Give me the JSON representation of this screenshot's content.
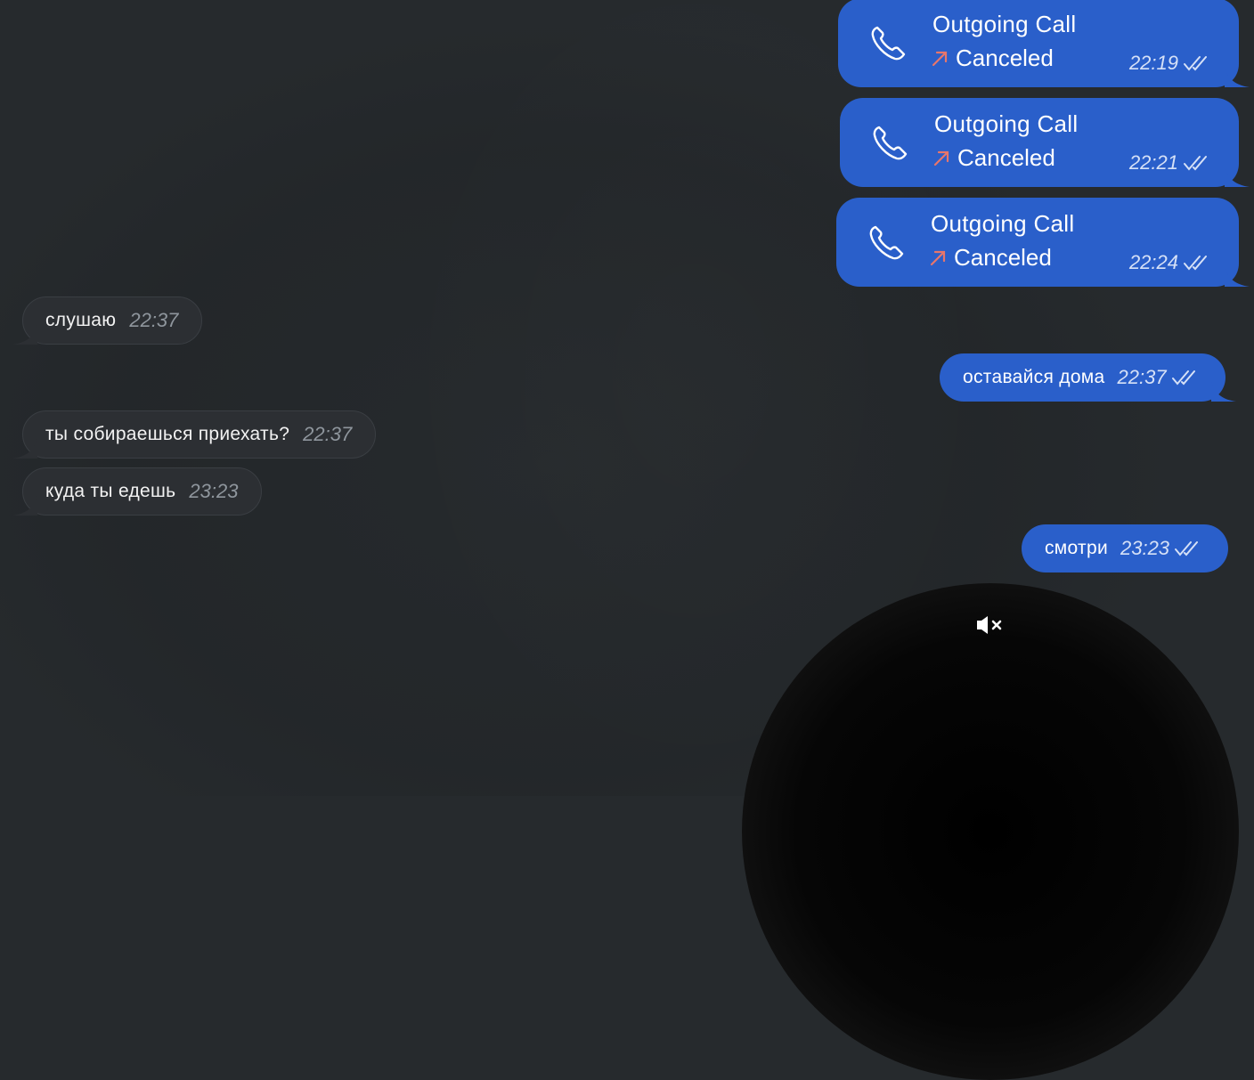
{
  "colors": {
    "background": "#262a2d",
    "outgoing_bubble": "#2a5fca",
    "incoming_bubble": "#2c2f33",
    "canceled_arrow": "#e8766b",
    "meta_text": "#d6e1f7",
    "incoming_time": "#8f969d"
  },
  "calls": [
    {
      "title": "Outgoing Call",
      "status": "Canceled",
      "time": "22:19",
      "icon": "phone-icon",
      "status_icon": "arrow-up-right-icon",
      "read": "double-check-icon"
    },
    {
      "title": "Outgoing Call",
      "status": "Canceled",
      "time": "22:21",
      "icon": "phone-icon",
      "status_icon": "arrow-up-right-icon",
      "read": "double-check-icon"
    },
    {
      "title": "Outgoing Call",
      "status": "Canceled",
      "time": "22:24",
      "icon": "phone-icon",
      "status_icon": "arrow-up-right-icon",
      "read": "double-check-icon"
    }
  ],
  "incoming": [
    {
      "text": "слушаю",
      "time": "22:37"
    },
    {
      "text": "ты собираешься приехать?",
      "time": "22:37"
    },
    {
      "text": "куда ты едешь",
      "time": "23:23"
    }
  ],
  "outgoing": [
    {
      "text": "оставайся дома",
      "time": "22:37",
      "read": "double-check-icon"
    },
    {
      "text": "смотри",
      "time": "23:23",
      "read": "double-check-icon"
    }
  ],
  "video_message": {
    "sound_state": "muted",
    "icon": "speaker-muted-icon"
  }
}
